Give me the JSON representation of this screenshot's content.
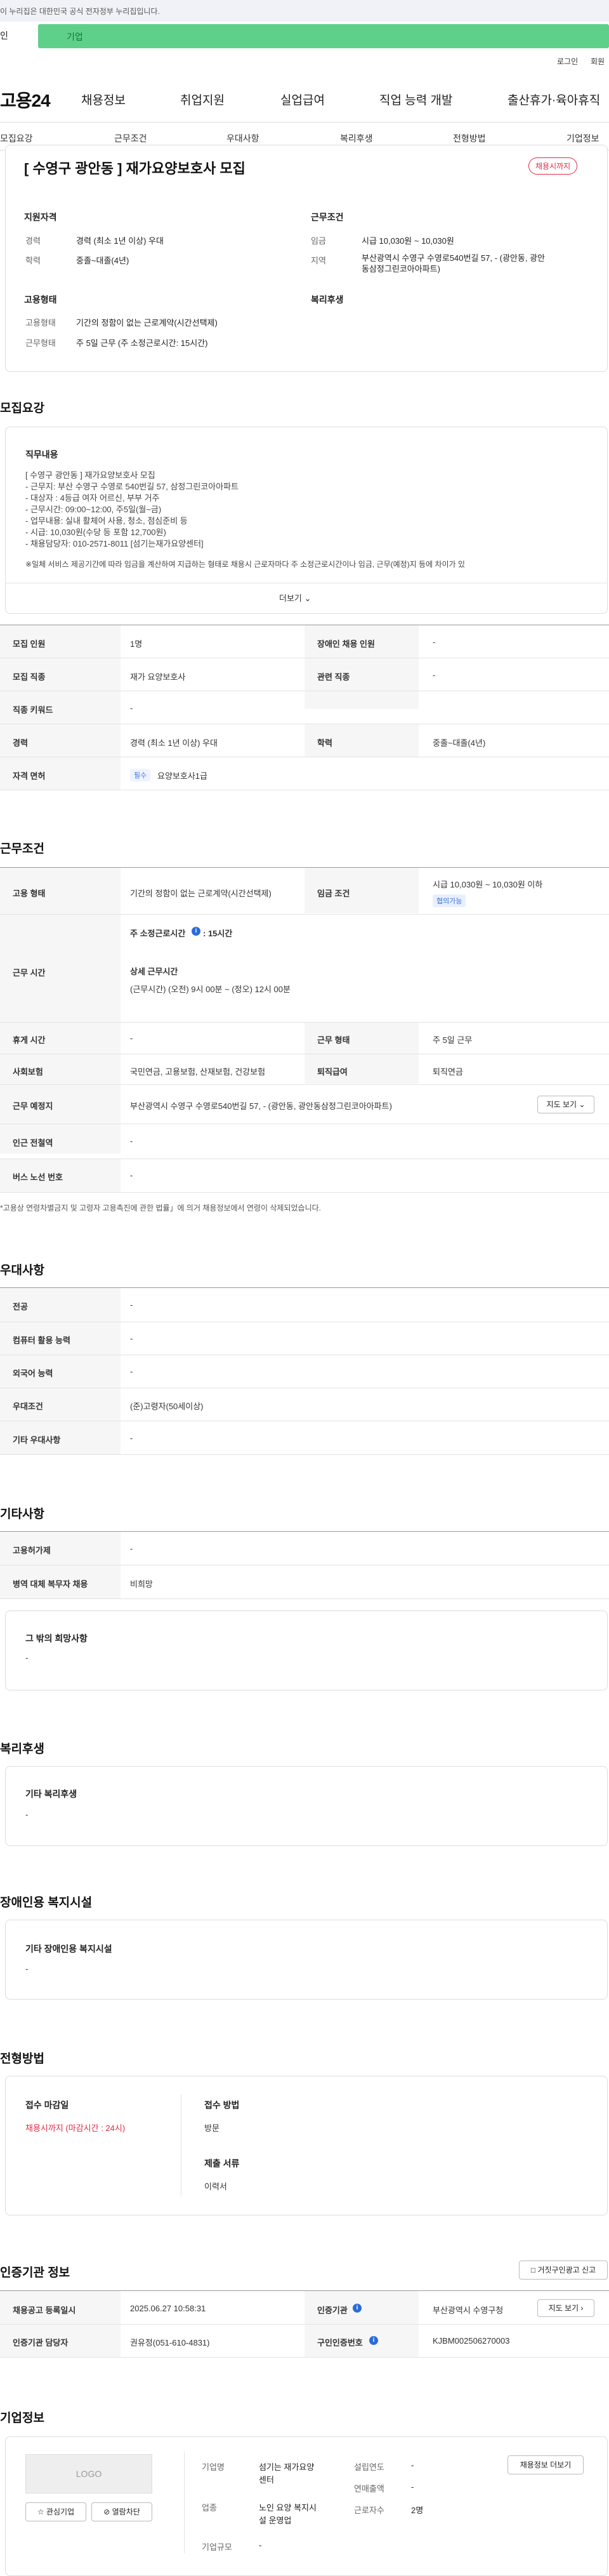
{
  "gov_banner": "이 누리집은 대한민국 공식 전자정부 누리집입니다.",
  "login": {
    "left_label": "인",
    "green_label": "기업"
  },
  "util": {
    "login": "로그인",
    "join": "회원"
  },
  "nav": {
    "logo": "고용24",
    "items": [
      "채용정보",
      "취업지원",
      "실업급여",
      "직업 능력 개발",
      "출산휴가·육아휴직"
    ]
  },
  "tabs": [
    "모집요강",
    "근무조건",
    "우대사항",
    "복리후생",
    "전형방법",
    "기업정보"
  ],
  "header": {
    "title": "[ 수영구 광안동 ] 재가요양보호사 모집",
    "badge": "채용시까지",
    "qual_h": "지원자격",
    "cond_h": "근무조건",
    "career_k": "경력",
    "career_v": "경력 (최소 1년 이상) 우대",
    "edu_k": "학력",
    "edu_v": "중졸~대졸(4년)",
    "wage_k": "임금",
    "wage_v": "시급 10,030원 ~ 10,030원",
    "region_k": "지역",
    "region_v1": "부산광역시 수영구 수영로540번길 57, - (광안동, 광안",
    "region_v2": "동삼정그린코아아파트)",
    "emp_h": "고용형태",
    "welfare_h": "복리후생",
    "emptype_k": "고용형태",
    "emptype_v": "기간의 정함이 없는 근로계약(시간선택제)",
    "worktype_k": "근무형태",
    "worktype_v": "주 5일 근무 (주 소정근로시간: 15시간)"
  },
  "recruit": {
    "h": "모집요강",
    "duty_h": "직무내용",
    "duty_lines": [
      "[ 수영구 광안동 ] 재가요양보호사 모집",
      "- 근무지: 부산 수영구 수영로 540번길 57, 삼정그린코아아파트",
      "- 대상자 : 4등급 여자 어르신, 부부 거주",
      "- 근무시간: 09:00~12:00, 주5일(월~금)",
      "- 업무내용: 실내 활체어 사용, 청소, 점심준비 등",
      "- 시급: 10,030원(수당 등 포함 12,700원)",
      "- 채용담당자: 010-2571-8011 [섬기는재가요양센터]",
      "",
      "※일체 서비스 제공기간에 따라 임금을 계산하여 지급하는 형태로 채용시 근로자마다 주 소정근로시간이나 임금, 근무(예정)지 등에 차이가 있"
    ],
    "more": "더보기",
    "rows": [
      {
        "k1": "모집 인원",
        "v1": "1명",
        "k2": "장애인 채용 인원",
        "v2": "-"
      },
      {
        "k1": "모집 직종",
        "v1": "재가 요양보호사",
        "k2": "관련 직종",
        "v2": "-"
      },
      {
        "k1": "직종 키워드",
        "v1": "-"
      },
      {
        "k1": "경력",
        "v1": "경력 (최소 1년 이상) 우대",
        "k2": "학력",
        "v2": "중졸~대졸(4년)"
      }
    ],
    "cert_k": "자격 면허",
    "cert_chip": "필수",
    "cert_v": "요양보호사1급"
  },
  "conditions": {
    "h": "근무조건",
    "emp_k": "고용 형태",
    "emp_v": "기간의 정함이 없는 근로계약(시간선택제)",
    "wage_k": "임금 조건",
    "wage_v": "시급 10,030원 ~ 10,030원 이하",
    "wage_chip": "협의가능",
    "time_k": "근무 시간",
    "weekly_label": "주 소정근로시간",
    "weekly_val": ": 15시간",
    "detail_h": "상세 근무시간",
    "detail_v": "(근무시간) (오전) 9시 00분 ~ (정오) 12시 00분",
    "rest_k": "휴게 시간",
    "rest_v": "-",
    "form_k": "근무 형태",
    "form_v": "주 5일 근무",
    "ins_k": "사회보험",
    "ins_v": "국민연금, 고용보험, 산재보험, 건강보험",
    "ret_k": "퇴직급여",
    "ret_v": "퇴직연금",
    "loc_k": "근무 예정지",
    "loc_v": "부산광역시 수영구 수영로540번길 57, - (광안동, 광안동삼정그린코아아파트)",
    "map_btn": "지도 보기",
    "sub_k": "인근 전철역",
    "sub_v": "-",
    "bus_k": "버스 노선 번호",
    "bus_v": "-",
    "note": "*고용상 연령차별금지 및 고령자 고용촉진에 관한 법률」에 의거 채용정보에서 연령이 삭제되었습니다."
  },
  "pref": {
    "h": "우대사항",
    "rows": [
      {
        "k": "전공",
        "v": "-"
      },
      {
        "k": "컴퓨터 활용 능력",
        "v": "-"
      },
      {
        "k": "외국어 능력",
        "v": "-"
      },
      {
        "k": "우대조건",
        "v": "(준)고령자(50세이상)"
      },
      {
        "k": "기타 우대사항",
        "v": "-"
      }
    ]
  },
  "etc": {
    "h": "기타사항",
    "rows": [
      {
        "k": "고용허가제",
        "v": "-"
      },
      {
        "k": "병역 대체 복무자 채용",
        "v": "비희망"
      }
    ],
    "other_h": "그 밖의 희망사항",
    "other_v": "-"
  },
  "welfare": {
    "h": "복리후생",
    "sub_h": "기타 복리후생",
    "sub_v": "-"
  },
  "disabled": {
    "h": "장애인용 복지시설",
    "sub_h": "기타 장애인용 복지시설",
    "sub_v": "-"
  },
  "selection": {
    "h": "전형방법",
    "deadline_h": "접수 마감일",
    "deadline_v": "채용시까지 (마감시간 : 24시)",
    "method_h": "접수 방법",
    "method_v": "방문",
    "docs_h": "제출 서류",
    "docs_v": "이력서"
  },
  "agency": {
    "h": "인증기관 정보",
    "report_btn": "거짓구인광고 신고",
    "reg_k": "채용공고 등록일시",
    "reg_v": "2025.06.27 10:58:31",
    "inst_k": "인증기관",
    "inst_v": "부산광역시 수영구청",
    "map_btn": "지도 보기",
    "mgr_k": "인증기관 담당자",
    "mgr_v": "권유정(051-610-4831)",
    "num_k": "구인인증번호",
    "num_v": "KJBM002506270003"
  },
  "company": {
    "h": "기업정보",
    "logo": "LOGO",
    "fav_btn": "관심기업",
    "block_btn": "열람차단",
    "name_k": "기업명",
    "name_v1": "섬기는 재가요양",
    "name_v2": "센터",
    "ind_k": "업종",
    "ind_v1": "노인 요양 복지시",
    "ind_v2": "설 운영업",
    "size_k": "기업규모",
    "size_v": "-",
    "est_k": "설립연도",
    "est_v": "-",
    "sales_k": "연매출액",
    "sales_v": "-",
    "emp_k": "근로자수",
    "emp_v": "2명",
    "jobs_btn": "채용정보 더보기"
  }
}
